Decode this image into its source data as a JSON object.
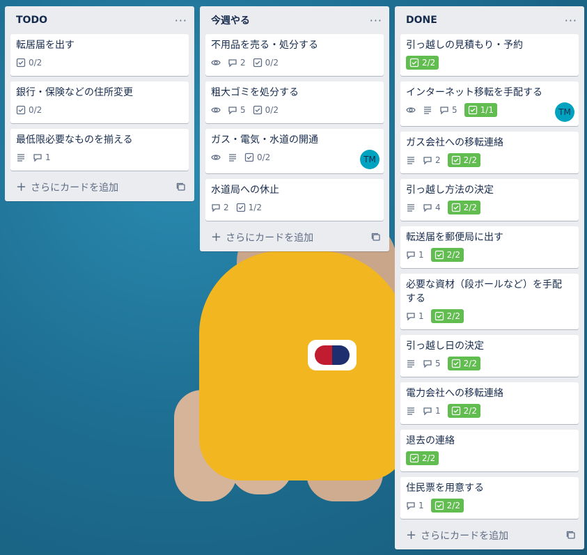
{
  "lists": [
    {
      "title": "TODO",
      "cards": [
        {
          "title": "転居届を出す",
          "checklist": "0/2"
        },
        {
          "title": "銀行・保険などの住所変更",
          "checklist": "0/2"
        },
        {
          "title": "最低限必要なものを揃える",
          "comments": "1"
        }
      ],
      "add_label": "さらにカードを追加"
    },
    {
      "title": "今週やる",
      "cards": [
        {
          "title": "不用品を売る・処分する",
          "comments": "2",
          "checklist": "0/2"
        },
        {
          "title": "粗大ゴミを処分する",
          "comments": "5",
          "checklist": "0/2"
        },
        {
          "title": "ガス・電気・水道の開通",
          "checklist": "0/2",
          "avatar": "TM"
        },
        {
          "title": "水道局への休止",
          "comments": "2",
          "checklist": "1/2"
        }
      ],
      "add_label": "さらにカードを追加"
    },
    {
      "title": "DONE",
      "cards": [
        {
          "title": "引っ越しの見積もり・予約",
          "checklist": "2/2"
        },
        {
          "title": "インターネット移転を手配する",
          "comments": "5",
          "checklist": "1/1",
          "avatar": "TM"
        },
        {
          "title": "ガス会社への移転連絡",
          "comments": "2",
          "checklist": "2/2"
        },
        {
          "title": "引っ越し方法の決定",
          "comments": "4",
          "checklist": "2/2"
        },
        {
          "title": "転送届を郵便局に出す",
          "comments": "1",
          "checklist": "2/2"
        },
        {
          "title": "必要な資材（段ボールなど）を手配する",
          "comments": "1",
          "checklist": "2/2"
        },
        {
          "title": "引っ越し日の決定",
          "comments": "5",
          "checklist": "2/2"
        },
        {
          "title": "電力会社への移転連絡",
          "comments": "1",
          "checklist": "2/2"
        },
        {
          "title": "退去の連絡",
          "checklist": "2/2"
        },
        {
          "title": "住民票を用意する",
          "comments": "1",
          "checklist": "2/2"
        }
      ],
      "add_label": "さらにカードを追加"
    }
  ],
  "menu_glyph": "···",
  "colors": {
    "complete": "#61bd4f",
    "avatar": "#00a3bf"
  }
}
